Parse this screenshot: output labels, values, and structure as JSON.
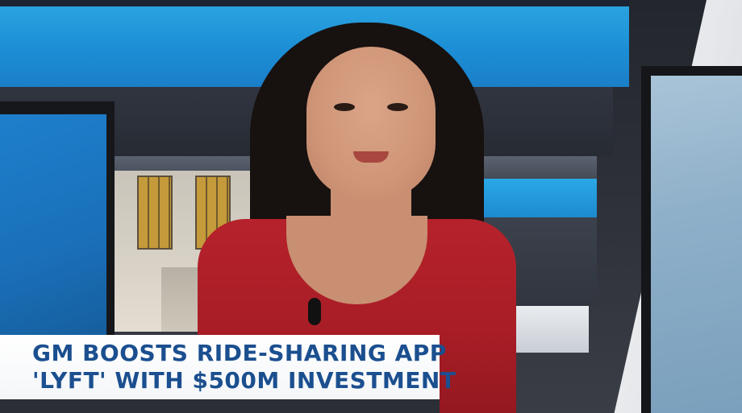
{
  "lower_third": {
    "headline_line1": "GM BOOSTS RIDE-SHARING APP",
    "headline_line2": "'LYFT' WITH $500M INVESTMENT",
    "text_color": "#1b4f8f",
    "background_color": "#ffffff"
  },
  "scene": {
    "accent_blue": "#1d8fd6",
    "presenter_top_color": "#a71d26"
  }
}
